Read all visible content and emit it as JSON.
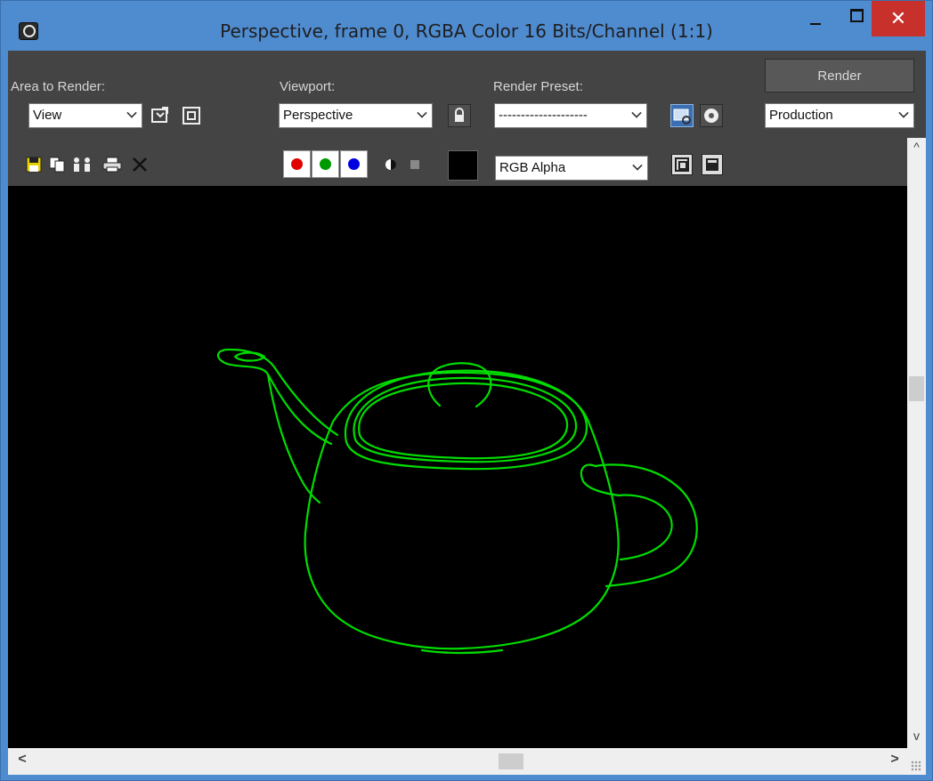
{
  "window": {
    "title": "Perspective, frame 0, RGBA Color 16 Bits/Channel (1:1)",
    "app_icon": "3dsmax-logo-icon",
    "controls": [
      "minimize-icon",
      "maximize-icon",
      "close-icon"
    ],
    "close_glyph": "✕"
  },
  "toolbar": {
    "area_to_render_label": "Area to Render:",
    "area_to_render_value": "View",
    "viewport_label": "Viewport:",
    "viewport_value": "Perspective",
    "render_preset_label": "Render Preset:",
    "render_preset_value": "--------------------",
    "render_button": "Render",
    "production_value": "Production"
  },
  "second_toolbar": {
    "channel_value": "RGB Alpha",
    "colors": {
      "red": "#e00000",
      "green": "#00a000",
      "blue": "#0000e0"
    }
  },
  "viewport": {
    "background": "#000000",
    "wire_color": "#00dd00",
    "subject": "teapot wireframe"
  },
  "scrollbars": {
    "up_glyph": "^",
    "down_glyph": "v",
    "left_glyph": "<",
    "right_glyph": ">"
  }
}
